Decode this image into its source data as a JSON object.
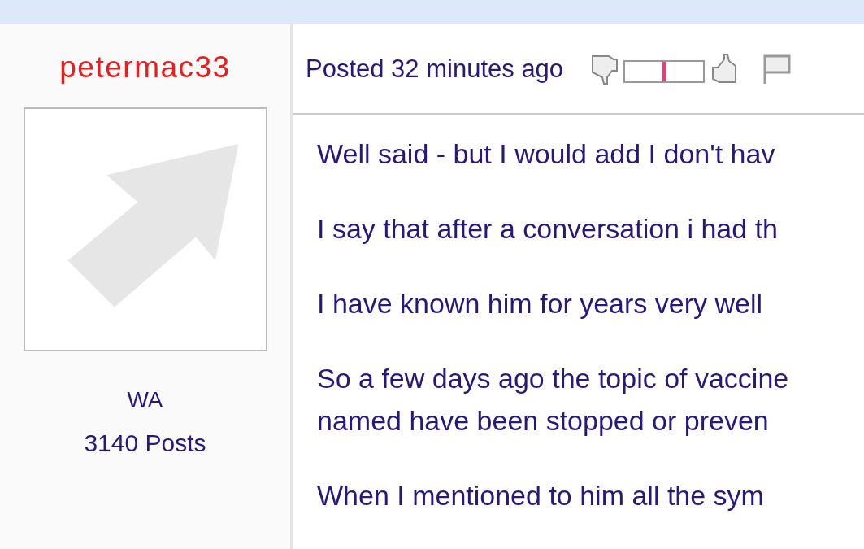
{
  "author": {
    "username": "petermac33",
    "avatar": {
      "kind": "default"
    },
    "location": "WA",
    "post_count": "3140 Posts"
  },
  "post": {
    "posted": "Posted 32 minutes ago",
    "rating": {
      "level": 0.5
    },
    "paragraphs": [
      {
        "lines": [
          "Well said - but I would add I don't hav"
        ]
      },
      {
        "lines": [
          "I say that after a conversation i had th"
        ]
      },
      {
        "lines": [
          "I have known him for years very well"
        ]
      },
      {
        "lines": [
          "So a few days ago the topic of vaccine",
          "named have been stopped or preven"
        ]
      },
      {
        "lines": [
          "When I mentioned to him all the sym"
        ]
      }
    ]
  }
}
